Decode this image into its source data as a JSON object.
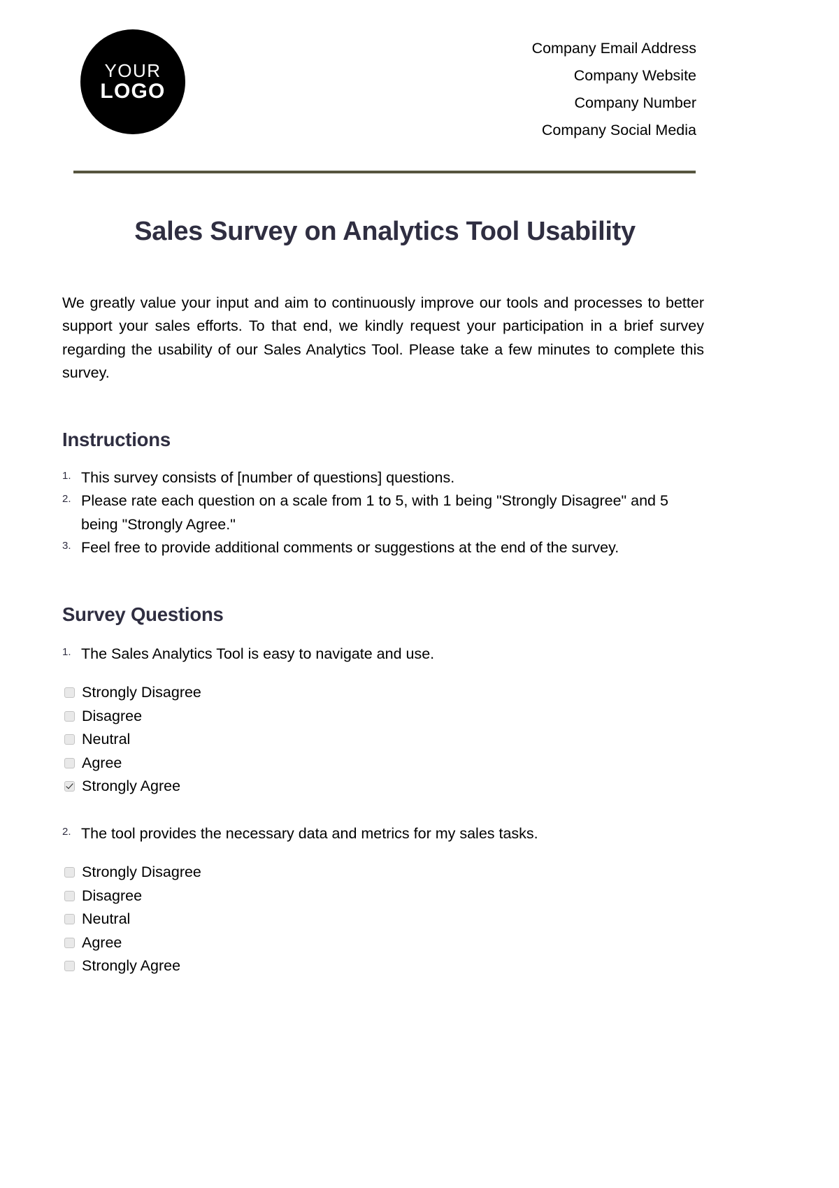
{
  "header": {
    "logo": {
      "line1": "YOUR",
      "line2": "LOGO"
    },
    "contact_lines": [
      "Company Email Address",
      "Company Website",
      "Company Number",
      "Company Social Media"
    ],
    "divider_color": "#56553f"
  },
  "document": {
    "title": "Sales Survey on Analytics Tool Usability",
    "title_color": "#2f2e41",
    "intro": "We greatly value your input and aim to continuously improve our tools and processes to better support your sales efforts. To that end, we kindly request your participation in a brief survey regarding the usability of our Sales Analytics Tool. Please take a few minutes to complete this survey."
  },
  "instructions": {
    "heading": "Instructions",
    "items": [
      "This survey consists of [number of questions] questions.",
      "Please rate each question on a scale from 1 to 5, with 1 being \"Strongly Disagree\" and 5 being \"Strongly Agree.\"",
      "Feel free to provide additional comments or suggestions at the end of the survey."
    ]
  },
  "survey": {
    "heading": "Survey Questions",
    "questions": [
      {
        "text": "The Sales Analytics Tool is easy to navigate and use.",
        "options": [
          {
            "label": "Strongly Disagree",
            "checked": false
          },
          {
            "label": "Disagree",
            "checked": false
          },
          {
            "label": "Neutral",
            "checked": false
          },
          {
            "label": "Agree",
            "checked": false
          },
          {
            "label": "Strongly Agree",
            "checked": true
          }
        ]
      },
      {
        "text": "The tool provides the necessary data and metrics for my sales tasks.",
        "options": [
          {
            "label": "Strongly Disagree",
            "checked": false
          },
          {
            "label": "Disagree",
            "checked": false
          },
          {
            "label": "Neutral",
            "checked": false
          },
          {
            "label": "Agree",
            "checked": false
          },
          {
            "label": "Strongly Agree",
            "checked": false
          }
        ]
      }
    ]
  }
}
